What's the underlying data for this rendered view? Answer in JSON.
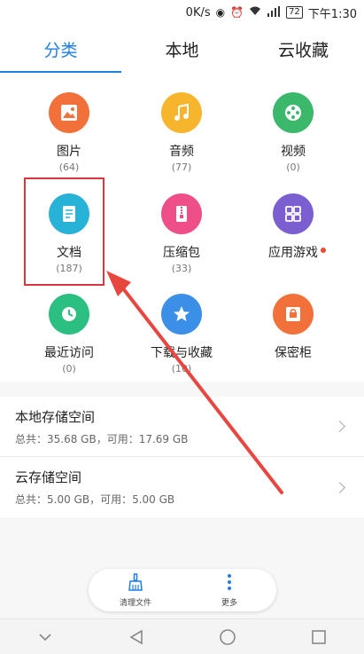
{
  "status_bar": {
    "speed": "0K/s",
    "battery": "72",
    "time": "下午1:30"
  },
  "tabs": [
    {
      "label": "分类",
      "active": true
    },
    {
      "label": "本地",
      "active": false
    },
    {
      "label": "云收藏",
      "active": false
    }
  ],
  "categories": [
    {
      "name": "图片",
      "count": "(64)",
      "color": "#f2703a",
      "icon": "image-icon"
    },
    {
      "name": "音频",
      "count": "(77)",
      "color": "#f6b52d",
      "icon": "music-icon"
    },
    {
      "name": "视频",
      "count": "(0)",
      "color": "#3bb86b",
      "icon": "video-reel-icon"
    },
    {
      "name": "文档",
      "count": "(187)",
      "color": "#28b2d8",
      "icon": "document-icon"
    },
    {
      "name": "压缩包",
      "count": "(33)",
      "color": "#ef4f88",
      "icon": "zip-icon"
    },
    {
      "name": "应用游戏",
      "count": "",
      "color": "#7b5fd1",
      "icon": "apps-icon"
    },
    {
      "name": "最近访问",
      "count": "(0)",
      "color": "#2bbf82",
      "icon": "clock-icon"
    },
    {
      "name": "下载与收藏",
      "count": "(10)",
      "color": "#3b8fe6",
      "icon": "star-icon"
    },
    {
      "name": "保密柜",
      "count": "",
      "color": "#f2703a",
      "icon": "safe-icon"
    }
  ],
  "storage": {
    "local": {
      "title": "本地存储空间",
      "info": "总共：35.68 GB，可用：17.69 GB"
    },
    "cloud": {
      "title": "云存储空间",
      "info": "总共：5.00 GB，可用：5.00 GB"
    }
  },
  "toolbar": {
    "clean_label": "清理文件",
    "more_label": "更多"
  },
  "colors": {
    "accent": "#1e7fe6",
    "highlight": "#d9363e",
    "notification_dot": "#f04a32"
  }
}
